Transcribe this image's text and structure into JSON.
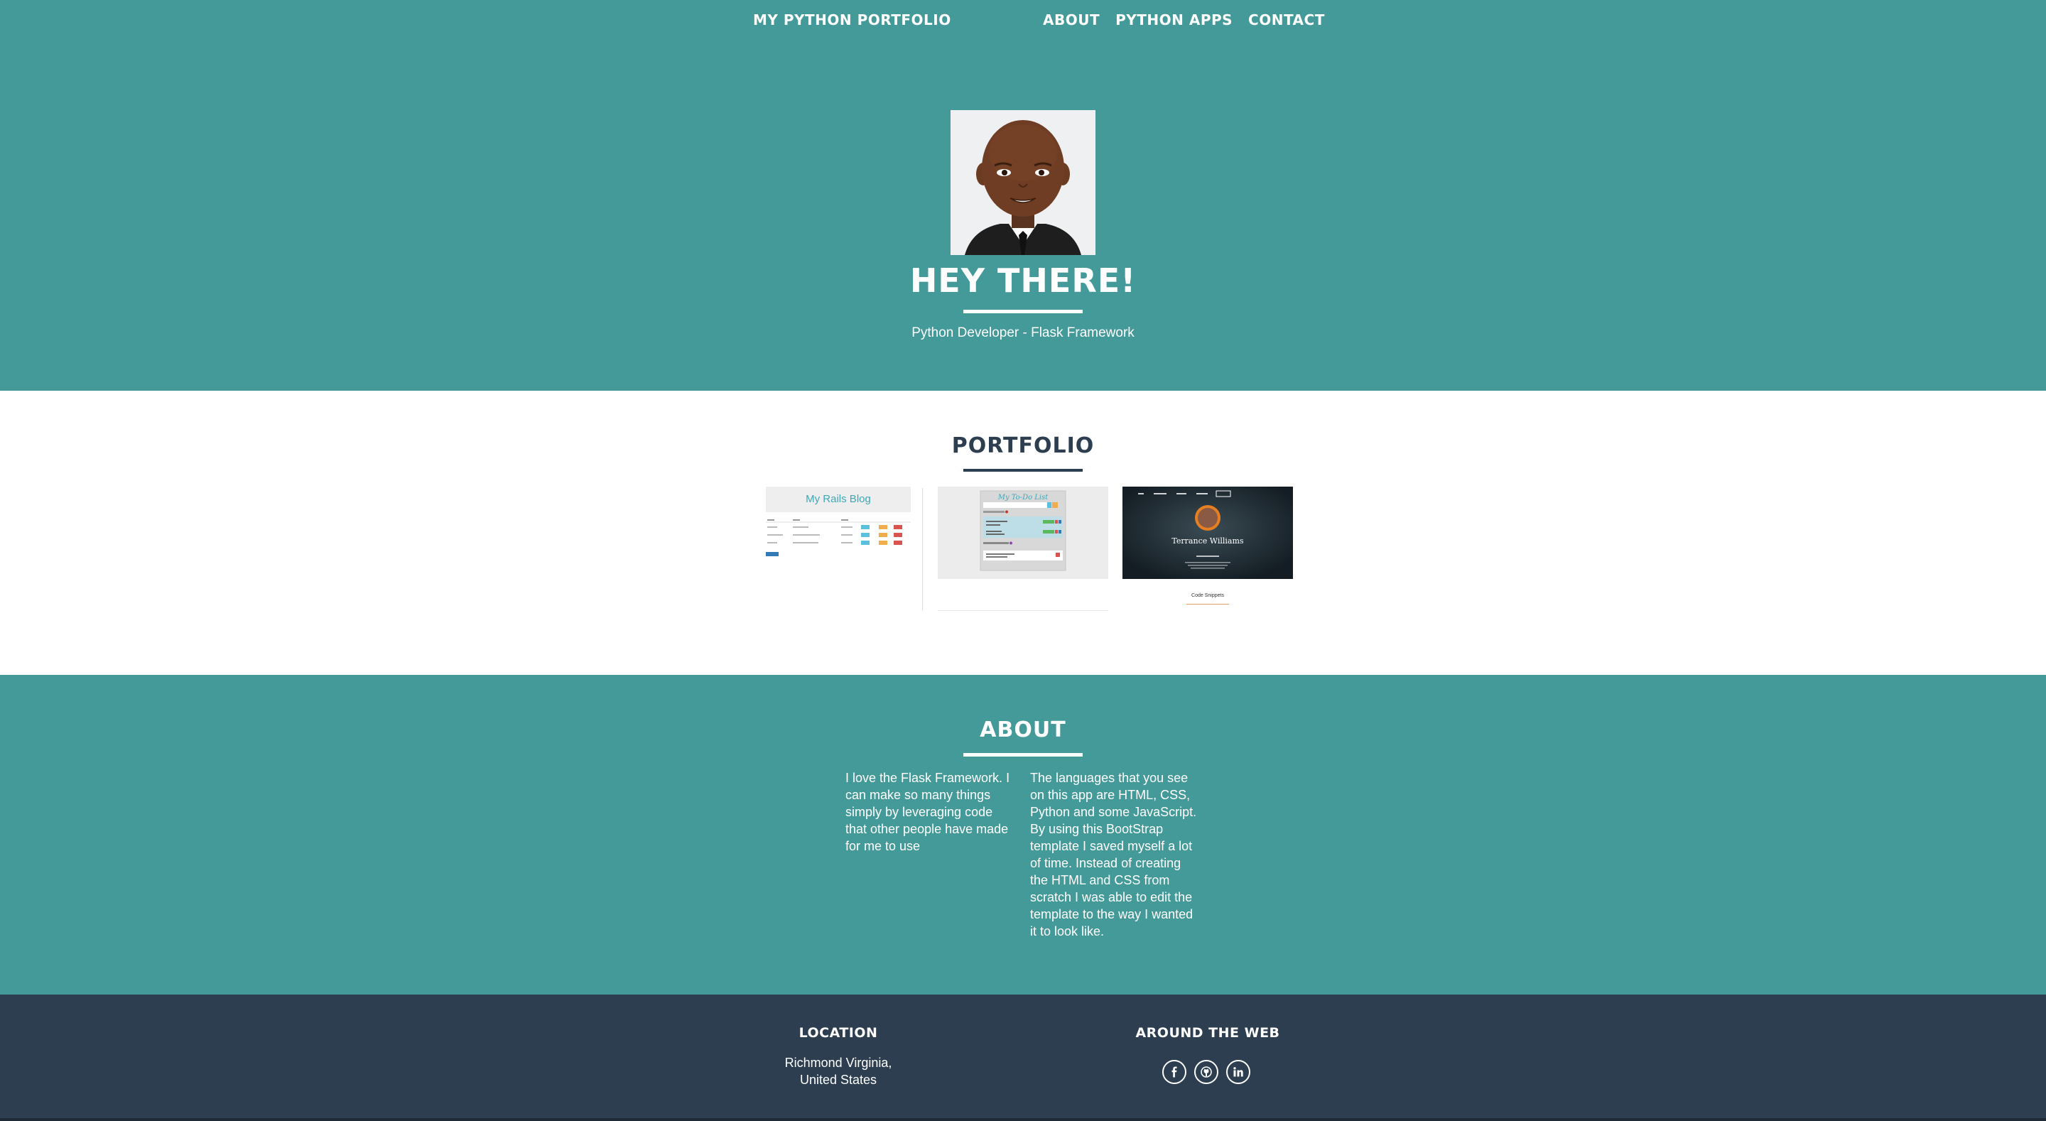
{
  "nav": {
    "brand": "MY PYTHON PORTFOLIO",
    "links": [
      "ABOUT",
      "PYTHON APPS",
      "CONTACT"
    ]
  },
  "hero": {
    "title": "HEY THERE!",
    "subtitle": "Python Developer - Flask Framework"
  },
  "portfolio": {
    "title": "PORTFOLIO",
    "items": [
      {
        "screenshot_title": "My Rails Blog"
      },
      {
        "screenshot_title": "My To-Do List"
      },
      {
        "screenshot_title": "Terrance Williams",
        "caption": "Code Snippets"
      }
    ]
  },
  "about": {
    "title": "ABOUT",
    "col1": "I love the Flask Framework. I can make so many things simply by leveraging code that other people have made for me to use",
    "col2": "The languages that you see on this app are HTML, CSS, Python and some JavaScript. By using this BootStrap template I saved myself a lot of time. Instead of creating the HTML and CSS from scratch I was able to edit the template to the way I wanted it to look like."
  },
  "footer": {
    "location_heading": "LOCATION",
    "location_line1": "Richmond Virginia,",
    "location_line2": "United States",
    "web_heading": "AROUND THE WEB",
    "social_icons": [
      "facebook-icon",
      "github-icon",
      "linkedin-icon"
    ]
  },
  "colors": {
    "primary": "#449999",
    "dark": "#2c3e50"
  }
}
